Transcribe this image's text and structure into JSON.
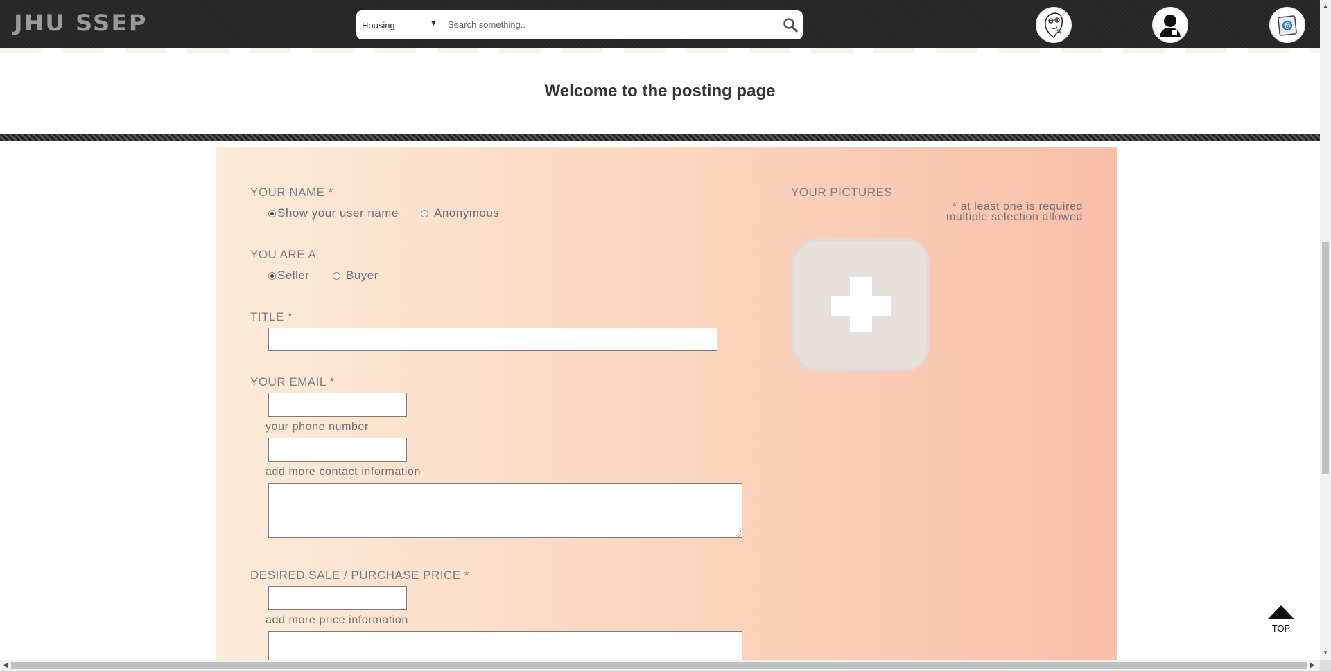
{
  "header": {
    "logo": "JHU SSEP",
    "search": {
      "category": "Housing",
      "placeholder": "Search something.."
    },
    "icons": [
      "meme-avatar-icon",
      "user-profile-icon",
      "mail-icon"
    ]
  },
  "welcome": "Welcome to the posting page",
  "form": {
    "name_label": "YOUR NAME *",
    "name_options": [
      "Show your user name",
      "Anonymous"
    ],
    "name_selected": "Show your user name",
    "role_label": "YOU ARE A",
    "role_options": [
      "Seller",
      "Buyer"
    ],
    "role_selected": "Seller",
    "title_label": "TITLE *",
    "email_label": "YOUR EMAIL *",
    "phone_label": "your phone number",
    "contact_label": "add more contact information",
    "price_label": "DESIRED SALE / PURCHASE PRICE *",
    "price_more_label": "add more price information",
    "pictures_label": "YOUR PICTURES",
    "pictures_note_1": "* at least one is required",
    "pictures_note_2": "multiple selection allowed"
  },
  "top_button": "TOP"
}
